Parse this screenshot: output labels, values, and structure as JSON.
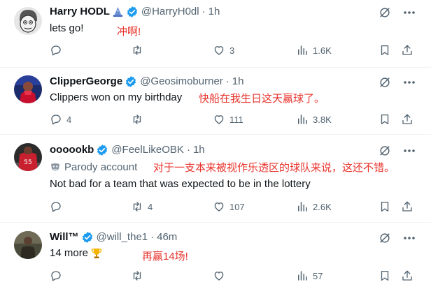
{
  "tweets": [
    {
      "name": "Harry HODL",
      "handle": "@HarryH0dl",
      "dot": "·",
      "time": "1h",
      "text": "lets go!",
      "translation": "冲啊!",
      "stats": {
        "replies": "",
        "retweets": "",
        "likes": "3",
        "views": "1.6K"
      },
      "avatar": "wojak-avatar"
    },
    {
      "name": "ClipperGeorge",
      "handle": "@Geosimoburner",
      "dot": "·",
      "time": "1h",
      "text": "Clippers won on my birthday",
      "translation": "快船在我生日这天赢球了。",
      "stats": {
        "replies": "4",
        "retweets": "",
        "likes": "111",
        "views": "3.8K"
      },
      "avatar": "player-avatar"
    },
    {
      "name": "oooookb",
      "handle": "@FeelLikeOBK",
      "dot": "·",
      "time": "1h",
      "label": "Parody account",
      "translation": "对于一支本来被视作乐透区的球队来说，这还不错。",
      "text": "Not bad for a team that was expected to be in the lottery",
      "stats": {
        "replies": "",
        "retweets": "4",
        "likes": "107",
        "views": "2.6K"
      },
      "avatar": "jersey-avatar"
    },
    {
      "name": "Will™",
      "handle": "@will_the1",
      "dot": "·",
      "time": "46m",
      "text": "14 more",
      "translation": "再赢14场!",
      "stats": {
        "replies": "",
        "retweets": "",
        "likes": "",
        "views": "57"
      },
      "avatar": "person-avatar"
    }
  ],
  "colors": {
    "verified": "#1d9bf0",
    "muted": "#536471",
    "translation": "#e8332c",
    "divider": "#eff3f4"
  }
}
